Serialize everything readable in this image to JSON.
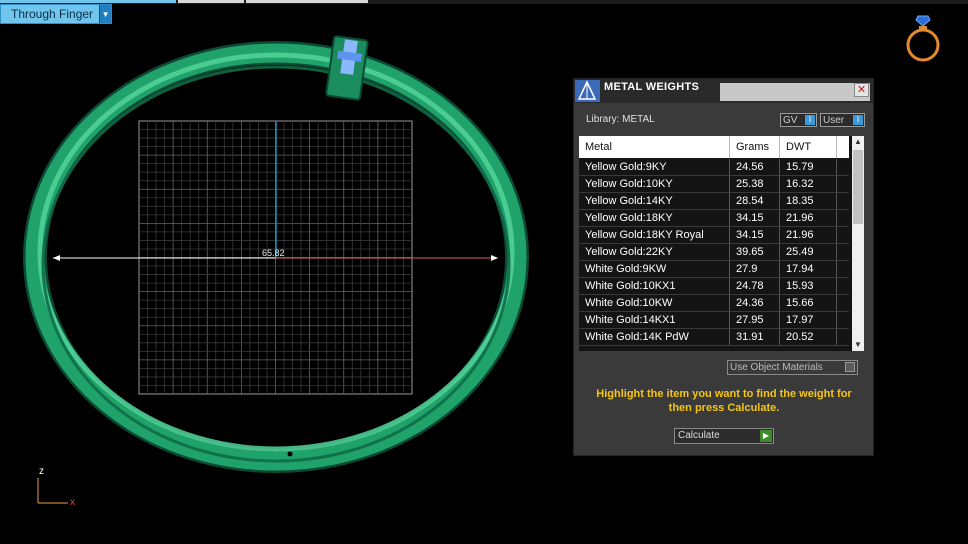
{
  "viewport": {
    "view_mode": "Through Finger",
    "measurement": "65.82",
    "axis_z": "z",
    "axis_x": "x"
  },
  "dialog": {
    "title": "METAL WEIGHTS",
    "close_glyph": "✕",
    "library_label": "Library: METAL",
    "gv_label": "GV",
    "user_label": "User",
    "toggle_indicator": "I",
    "columns": [
      "Metal",
      "Grams",
      "DWT"
    ],
    "rows": [
      {
        "metal": "Yellow Gold:9KY",
        "grams": "24.56",
        "dwt": "15.79"
      },
      {
        "metal": "Yellow Gold:10KY",
        "grams": "25.38",
        "dwt": "16.32"
      },
      {
        "metal": "Yellow Gold:14KY",
        "grams": "28.54",
        "dwt": "18.35"
      },
      {
        "metal": "Yellow Gold:18KY",
        "grams": "34.15",
        "dwt": "21.96"
      },
      {
        "metal": "Yellow Gold:18KY Royal",
        "grams": "34.15",
        "dwt": "21.96"
      },
      {
        "metal": "Yellow Gold:22KY",
        "grams": "39.65",
        "dwt": "25.49"
      },
      {
        "metal": "White Gold:9KW",
        "grams": "27.9",
        "dwt": "17.94"
      },
      {
        "metal": "White Gold:10KX1",
        "grams": "24.78",
        "dwt": "15.93"
      },
      {
        "metal": "White Gold:10KW",
        "grams": "24.36",
        "dwt": "15.66"
      },
      {
        "metal": "White Gold:14KX1",
        "grams": "27.95",
        "dwt": "17.97"
      },
      {
        "metal": "White Gold:14K PdW",
        "grams": "31.91",
        "dwt": "20.52"
      }
    ],
    "use_object_materials": "Use Object Materials",
    "hint": "Highlight the item you want to find the weight for then press Calculate.",
    "calculate_label": "Calculate",
    "colors": {
      "hint": "#f5c518",
      "ring": "#1fa36b",
      "toggle": "#3d9ad9"
    }
  },
  "icons": {
    "dropdown": "chevron-down-icon",
    "close": "close-icon",
    "ring": "ring-icon",
    "go": "play-icon"
  }
}
